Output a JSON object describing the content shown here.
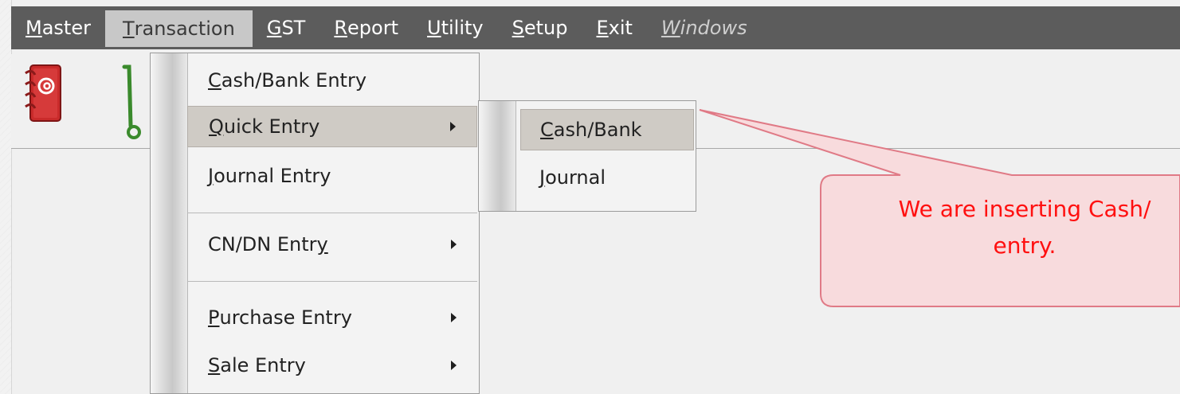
{
  "menubar": {
    "items": [
      {
        "pre": "",
        "u": "M",
        "post": "aster"
      },
      {
        "pre": "",
        "u": "T",
        "post": "ransaction"
      },
      {
        "pre": "",
        "u": "G",
        "post": "ST"
      },
      {
        "pre": "",
        "u": "R",
        "post": "eport"
      },
      {
        "pre": "",
        "u": "U",
        "post": "tility"
      },
      {
        "pre": "",
        "u": "S",
        "post": "etup"
      },
      {
        "pre": "",
        "u": "E",
        "post": "xit"
      },
      {
        "pre": "",
        "u": "W",
        "post": "indows"
      }
    ]
  },
  "toolbar": {
    "icons": [
      "address-book-icon",
      "hand-truck-icon"
    ]
  },
  "transaction_menu": {
    "items": [
      {
        "pre": "",
        "u": "C",
        "post": "ash/Bank Entry",
        "submenu": false
      },
      {
        "pre": "",
        "u": "Q",
        "post": "uick Entry",
        "submenu": true
      },
      {
        "pre": "",
        "u": "J",
        "post": "ournal Entry",
        "submenu": false
      },
      {
        "pre": "CN/DN Entr",
        "u": "y",
        "post": "",
        "submenu": true
      },
      {
        "pre": "",
        "u": "P",
        "post": "urchase Entry",
        "submenu": true
      },
      {
        "pre": "",
        "u": "S",
        "post": "ale Entry",
        "submenu": true
      }
    ]
  },
  "quick_entry_submenu": {
    "items": [
      {
        "pre": "",
        "u": "C",
        "post": "ash/Bank"
      },
      {
        "pre": "",
        "u": "J",
        "post": "ournal"
      }
    ]
  },
  "callout": {
    "line1": "We are inserting Cash/",
    "line2": "entry."
  },
  "colors": {
    "menubar_bg": "#5c5c5c",
    "menu_active_bg": "#c8c8c8",
    "hover_bg": "#cfcbc5",
    "callout_fill": "#f8dbdd",
    "callout_border": "#e07a86",
    "callout_text": "#ff1010"
  }
}
